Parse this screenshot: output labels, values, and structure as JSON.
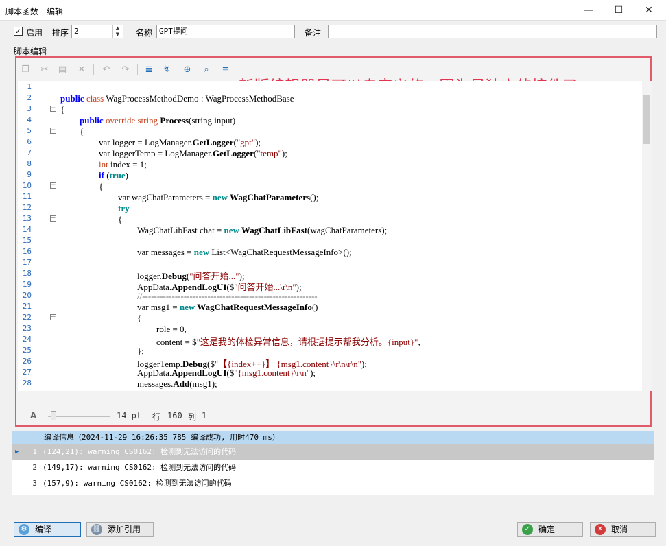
{
  "window": {
    "title": "脚本函数 - 编辑"
  },
  "form": {
    "enabled_label": "启用",
    "enabled_checked": "✓",
    "order_label": "排序",
    "order_value": "2",
    "name_label": "名称",
    "name_value": "GPT提问",
    "note_label": "备注",
    "note_value": ""
  },
  "editor": {
    "section_label": "脚本编辑",
    "annotation": "新版编辑器是可以自定义的，因为是独立的控件了",
    "line_numbers": [
      "1",
      "2",
      "3",
      "4",
      "5",
      "6",
      "7",
      "8",
      "9",
      "10",
      "11",
      "12",
      "13",
      "14",
      "15",
      "16",
      "17",
      "18",
      "19",
      "20",
      "21",
      "22",
      "23",
      "24",
      "25",
      "26",
      "27",
      "28"
    ],
    "status": {
      "zoom_label": "A",
      "font_size": "14 pt",
      "row_label": "行",
      "row_value": "160",
      "col_label": "列",
      "col_value": "1"
    }
  },
  "code": {
    "l2_kw1": "public",
    "l2_kw2": "class",
    "l2_name": "WagProcessMethodDemo : WagProcessMethodBase",
    "l3": "{",
    "l4_kw1": "public",
    "l4_kw2": "override",
    "l4_kw3": "string",
    "l4_m": "Process",
    "l4_rest": "(string input)",
    "l5": "{",
    "l6_a": "var logger = LogManager.",
    "l6_m": "GetLogger",
    "l6_b": "(",
    "l6_s": "\"gpt\"",
    "l6_c": ");",
    "l7_a": "var loggerTemp = LogManager.",
    "l7_m": "GetLogger",
    "l7_b": "(",
    "l7_s": "\"temp\"",
    "l7_c": ");",
    "l8_kw": "int",
    "l8_rest": " index = 1;",
    "l9_kw": "if",
    "l9_a": " (",
    "l9_kw2": "true",
    "l9_b": ")",
    "l10": "{",
    "l11_a": "var wagChatParameters = ",
    "l11_kw": "new",
    "l11_t": " WagChatParameters",
    "l11_b": "();",
    "l12_kw": "try",
    "l13": "{",
    "l14_a": "WagChatLibFast chat = ",
    "l14_kw": "new",
    "l14_t": " WagChatLibFast",
    "l14_b": "(wagChatParameters);",
    "l16_a": "var messages = ",
    "l16_kw": "new",
    "l16_b": " List<WagChatRequestMessageInfo>();",
    "l18_a": "logger.",
    "l18_m": "Debug",
    "l18_b": "(",
    "l18_s": "\"问答开始...\"",
    "l18_c": ");",
    "l19_a": "AppData.",
    "l19_m": "AppendLogUI",
    "l19_b": "($",
    "l19_s": "\"问答开始...\\r\\n\"",
    "l19_c": ");",
    "l20": "//-----------------------------------------------------------",
    "l21_a": "var msg1 = ",
    "l21_kw": "new",
    "l21_t": " WagChatRequestMessageInfo",
    "l21_b": "()",
    "l22": "{",
    "l23": "role = 0,",
    "l24_a": "content = $",
    "l24_s": "\"这是我的体检异常信息，请根据提示帮我分析。{input}\"",
    "l24_b": ",",
    "l25": "};",
    "l26_a": "loggerTemp.",
    "l26_m": "Debug",
    "l26_b": "($",
    "l26_s": "\"【{index++}】 {msg1.content}\\r\\n\\r\\n\"",
    "l26_c": ");",
    "l27_a": "AppData.",
    "l27_m": "AppendLogUI",
    "l27_b": "($",
    "l27_s": "\"{msg1.content}\\r\\n\"",
    "l27_c": ");",
    "l28_a": "messages.",
    "l28_m": "Add",
    "l28_b": "(msg1);"
  },
  "messages": {
    "header": "编译信息（2024-11-29 16:26:35 785 编译成功, 用时470 ms）",
    "rows": [
      {
        "num": "1",
        "text": "(124,21): warning CS0162: 检测到无法访问的代码"
      },
      {
        "num": "2",
        "text": "(149,17): warning CS0162: 检测到无法访问的代码"
      },
      {
        "num": "3",
        "text": "(157,9): warning CS0162: 检测到无法访问的代码"
      }
    ]
  },
  "buttons": {
    "compile": "编译",
    "add_ref": "添加引用",
    "ok": "确定",
    "cancel": "取消"
  },
  "colors": {
    "accent": "#1e6fb5",
    "annotation": "#e2344f",
    "frame": "#e05a6a",
    "header": "#b9d9f2"
  }
}
